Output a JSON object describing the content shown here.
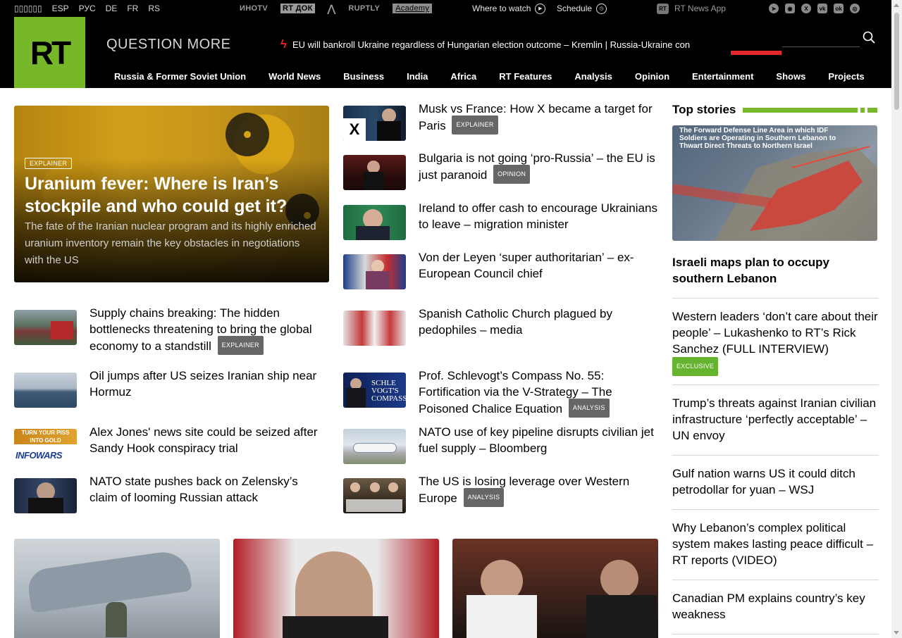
{
  "topbar": {
    "languages": [
      "ESP",
      "РУС",
      "DE",
      "FR",
      "RS"
    ],
    "first_lang": "▯▯▯▯▯▯",
    "partners": [
      "ИНОTV",
      "RT ДОК",
      "RUPTLY",
      "Academy"
    ],
    "where_to_watch": "Where to watch",
    "schedule": "Schedule",
    "news_app": "RT News App",
    "social_icons": [
      "telegram-icon",
      "rss-icon",
      "x-icon",
      "vk-icon",
      "odnoklassniki-icon",
      "rumble-icon"
    ]
  },
  "header": {
    "logo": "RT",
    "slogan": "QUESTION MORE",
    "ticker": "EU will bankroll Ukraine regardless of Hungarian election outcome – Kremlin | Russia-Ukraine con",
    "nav": [
      "Russia & Former Soviet Union",
      "World News",
      "Business",
      "India",
      "Africa",
      "RT Features",
      "Analysis",
      "Opinion",
      "Entertainment",
      "Shows",
      "Projects"
    ]
  },
  "hero": {
    "tag": "EXPLAINER",
    "title": "Uranium fever: Where is Iran’s stockpile and who could get it?",
    "summary": "The fate of the Iranian nuclear program and its highly enriched uranium inventory remain the key obstacles in negotiations with the US"
  },
  "left_list": [
    {
      "title": "Supply chains breaking: The hidden bottlenecks threatening to bring the global economy to a standstill",
      "tag": "EXPLAINER"
    },
    {
      "title": "Oil jumps after US seizes Iranian ship near Hormuz",
      "tag": ""
    },
    {
      "title": "Alex Jones' news site could be seized after Sandy Hook conspiracy trial",
      "tag": "",
      "thumb_text_1": "TURN YOUR PISS INTO GOLD",
      "thumb_text_2": "INFOWARS"
    },
    {
      "title": "NATO state pushes back on Zelensky’s claim of looming Russian attack",
      "tag": ""
    }
  ],
  "middle_list": [
    {
      "title": "Musk vs France: How X became a target for Paris",
      "tag": "EXPLAINER"
    },
    {
      "title": "Bulgaria is not going ‘pro-Russia’ – the EU is just paranoid",
      "tag": "OPINION"
    },
    {
      "title": "Ireland to offer cash to encourage Ukrainians to leave – migration minister",
      "tag": ""
    },
    {
      "title": "Von der Leyen ‘super authoritarian’ – ex-European Council chief",
      "tag": ""
    },
    {
      "title": "Spanish Catholic Church plagued by pedophiles – media",
      "tag": ""
    },
    {
      "title": "Prof. Schlevogt’s Compass No. 55: Fortification via the V-Strategy – The Poisoned Chalice Equation",
      "tag": "ANALYSIS",
      "thumb_text": "SCHLE VOGT'S COMPASS"
    },
    {
      "title": "NATO use of key pipeline disrupts civilian jet fuel supply – Bloomberg",
      "tag": ""
    },
    {
      "title": "The US is losing leverage over Western Europe",
      "tag": "ANALYSIS"
    }
  ],
  "top_stories": {
    "heading": "Top stories",
    "image_caption": "The Forward Defense Line Area in which IDF Soldiers are Operating in Southern Lebanon to Thwart Direct Threats to Northern Israel",
    "lead": "Israeli maps plan to occupy southern Lebanon",
    "items": [
      {
        "title": "Western leaders ‘don’t care about their people’ – Lukashenko to RT’s Rick Sanchez (FULL INTERVIEW)",
        "tag": "EXCLUSIVE"
      },
      {
        "title": "Trump’s threats against Iranian civilian infrastructure ‘perfectly acceptable’ – UN envoy",
        "tag": ""
      },
      {
        "title": "Gulf nation warns US it could ditch petrodollar for yuan – WSJ",
        "tag": ""
      },
      {
        "title": "Why Lebanon’s complex political system makes lasting peace difficult – RT reports (VIDEO)",
        "tag": ""
      },
      {
        "title": "Canadian PM explains country’s key weakness",
        "tag": ""
      }
    ]
  },
  "colors": {
    "brand_green": "#77b82a",
    "header_black": "#000000",
    "ticker_red": "#e3282d",
    "tag_grey": "#666666",
    "tag_green": "#65b32e"
  }
}
